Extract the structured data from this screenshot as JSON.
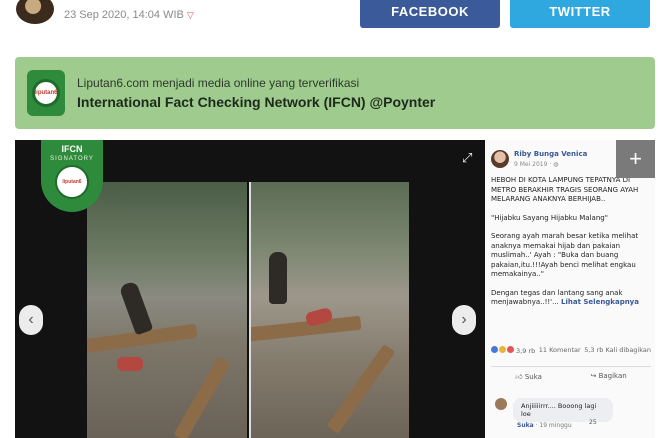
{
  "header": {
    "date": "23 Sep 2020, 14:04 WIB",
    "facebook_label": "FACEBOOK",
    "twitter_label": "TWITTER"
  },
  "banner": {
    "line1": "Liputan6.com menjadi media online yang terverifikasi",
    "line2": "International Fact Checking Network (IFCN) @Poynter",
    "logo_text": "liputan6"
  },
  "media": {
    "badge_title": "IFCN",
    "badge_subtitle": "SIGNATORY",
    "badge_seal": "liputan6",
    "prev_glyph": "‹",
    "next_glyph": "›",
    "expand_glyph": "⤢",
    "plus_glyph": "+"
  },
  "post": {
    "author": "Riby Bunga Venica",
    "date": "9 Mei 2019 · ◍",
    "paragraph1": "HEBOH DI KOTA LAMPUNG TEPATNYA DI METRO BERAKHIR TRAGIS SEORANG AYAH MELARANG ANAKNYA BERHIJAB..",
    "paragraph2": "\"Hijabku Sayang Hijabku Malang\"",
    "paragraph3": "Seorang ayah marah besar ketika melihat anaknya memakai hijab dan pakaian muslimah..' Ayah : \"Buka dan buang pakaian,itu.!!!Ayah benci melihat engkau memakainya..\"",
    "paragraph4": "Dengan tegas dan lantang sang anak menjawabnya..!!'...",
    "read_more": "Lihat Selengkapnya",
    "reaction_count": "3,9 rb",
    "comments": "11 Komentar",
    "shares": "5,3 rb Kali dibagikan",
    "like_label": "Suka",
    "share_label": "Bagikan",
    "comment_text": "Anjiiiiirrr.... Booong lagi loe",
    "comment_likes": "25",
    "comment_like_label": "Suka",
    "comment_time": "19 minggu"
  },
  "colors": {
    "facebook": "#3b5a9a",
    "twitter": "#2fa8e0",
    "banner": "#9fcb8e",
    "ifcn_green": "#2e8b3c"
  }
}
